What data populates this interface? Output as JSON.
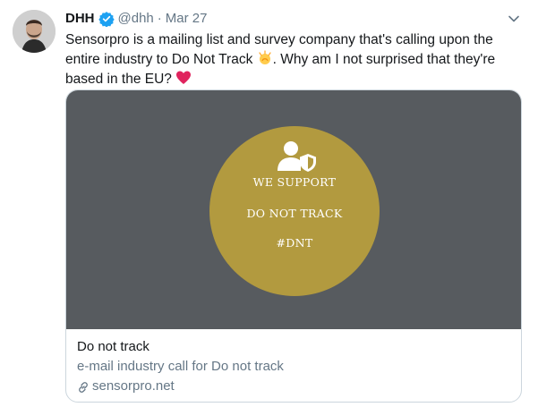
{
  "tweet": {
    "author_name": "DHH",
    "handle": "@dhh",
    "separator": "·",
    "date": "Mar 27",
    "text_part1": "Sensorpro is a mailing list and survey company that's calling upon the entire industry to Do Not Track ",
    "emoji1": "clapping-hands-emoji",
    "text_part2": ". Why am I not surprised that they're based in the EU? ",
    "emoji2": "red-heart-emoji"
  },
  "card": {
    "badge": {
      "line1": "WE SUPPORT",
      "line2": "DO NOT TRACK",
      "line3": "#DNT"
    },
    "title": "Do not track",
    "description": "e-mail industry call for Do not track",
    "domain": "sensorpro.net"
  },
  "colors": {
    "verified": "#1da1f2",
    "muted_text": "#657786",
    "card_media_bg": "#575b5f",
    "badge_gold": "#b29a3f",
    "heart": "#e0245e"
  }
}
